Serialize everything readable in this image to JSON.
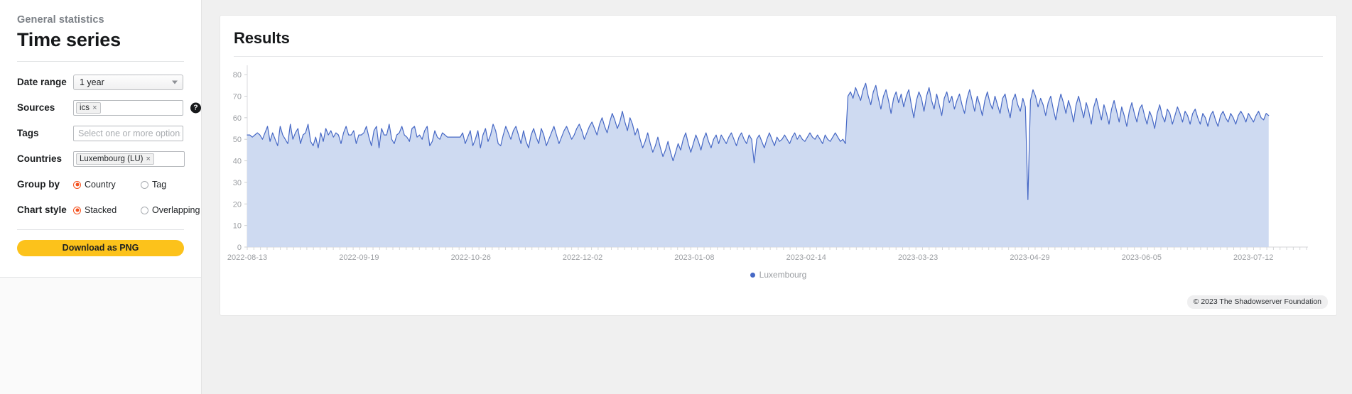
{
  "sidebar": {
    "eyebrow": "General statistics",
    "title": "Time series",
    "fields": {
      "date_range": {
        "label": "Date range",
        "value": "1 year"
      },
      "sources": {
        "label": "Sources",
        "chips": [
          "ics"
        ],
        "help_icon": "question-mark-icon"
      },
      "tags": {
        "label": "Tags",
        "placeholder": "Select one or more options...",
        "value": ""
      },
      "countries": {
        "label": "Countries",
        "chips": [
          "Luxembourg (LU)"
        ]
      },
      "group_by": {
        "label": "Group by",
        "selected": "Country",
        "options": [
          "Country",
          "Tag"
        ]
      },
      "chart_style": {
        "label": "Chart style",
        "selected": "Stacked",
        "options": [
          "Stacked",
          "Overlapping"
        ]
      }
    },
    "download_button": "Download as PNG",
    "chip_remove_icon": "×",
    "caret_icon": "chevron-down-icon"
  },
  "main": {
    "card_title": "Results",
    "copyright": "© 2023 The Shadowserver Foundation"
  },
  "colors": {
    "accent_radio": "#f4511e",
    "button": "#fcc21b",
    "series_line": "#4668c5",
    "series_fill": "#cbd8f0",
    "axis_text": "#9b9ea2",
    "page_bg": "#f0f0f0"
  },
  "chart_data": {
    "type": "area",
    "title": "Results",
    "xlabel": "",
    "ylabel": "",
    "ylim": [
      0,
      83
    ],
    "yticks": [
      0,
      10,
      20,
      30,
      40,
      50,
      60,
      70,
      80
    ],
    "grid": false,
    "legend": [
      "Luxembourg"
    ],
    "legend_position": "bottom",
    "stacked": true,
    "x_tick_labels": [
      "2022-08-13",
      "2022-09-19",
      "2022-10-26",
      "2022-12-02",
      "2023-01-08",
      "2023-02-14",
      "2023-03-23",
      "2023-04-29",
      "2023-06-05",
      "2023-07-12"
    ],
    "x_start": "2022-08-13",
    "x_end": "2023-08-12",
    "series": [
      {
        "name": "Luxembourg",
        "color": "#4668c5",
        "values": [
          52,
          52,
          51,
          52,
          53,
          52,
          50,
          53,
          56,
          49,
          53,
          50,
          47,
          56,
          52,
          50,
          48,
          57,
          50,
          53,
          55,
          48,
          52,
          53,
          57,
          49,
          47,
          51,
          46,
          53,
          49,
          55,
          52,
          54,
          51,
          53,
          52,
          48,
          53,
          56,
          52,
          52,
          54,
          48,
          52,
          52,
          53,
          56,
          51,
          47,
          54,
          56,
          46,
          55,
          52,
          52,
          57,
          50,
          48,
          52,
          53,
          56,
          52,
          51,
          49,
          55,
          56,
          51,
          52,
          50,
          54,
          56,
          47,
          49,
          54,
          51,
          50,
          53,
          52,
          51,
          51,
          51,
          51,
          51,
          51,
          53,
          48,
          51,
          54,
          47,
          50,
          54,
          46,
          52,
          55,
          49,
          52,
          57,
          54,
          48,
          47,
          52,
          56,
          53,
          50,
          54,
          56,
          52,
          48,
          54,
          49,
          46,
          52,
          55,
          51,
          48,
          55,
          52,
          47,
          50,
          53,
          56,
          52,
          48,
          51,
          54,
          56,
          53,
          50,
          52,
          55,
          57,
          54,
          50,
          53,
          56,
          58,
          55,
          52,
          57,
          60,
          56,
          53,
          58,
          62,
          59,
          55,
          58,
          63,
          58,
          54,
          60,
          57,
          52,
          55,
          50,
          46,
          49,
          53,
          48,
          44,
          47,
          51,
          46,
          42,
          45,
          49,
          44,
          40,
          44,
          48,
          45,
          50,
          53,
          48,
          44,
          48,
          52,
          49,
          45,
          50,
          53,
          49,
          46,
          50,
          52,
          48,
          52,
          50,
          48,
          51,
          53,
          50,
          47,
          51,
          53,
          50,
          48,
          52,
          50,
          39,
          50,
          52,
          49,
          46,
          50,
          53,
          50,
          47,
          51,
          49,
          50,
          52,
          50,
          48,
          51,
          53,
          50,
          52,
          50,
          49,
          51,
          53,
          51,
          50,
          52,
          50,
          48,
          52,
          50,
          49,
          51,
          53,
          51,
          49,
          50,
          48,
          70,
          72,
          69,
          74,
          71,
          68,
          73,
          76,
          70,
          66,
          72,
          75,
          69,
          64,
          70,
          73,
          68,
          62,
          69,
          72,
          67,
          71,
          65,
          70,
          73,
          66,
          60,
          68,
          72,
          69,
          63,
          70,
          74,
          68,
          64,
          71,
          66,
          61,
          69,
          72,
          67,
          70,
          64,
          68,
          71,
          66,
          62,
          69,
          73,
          68,
          63,
          70,
          66,
          61,
          68,
          72,
          67,
          64,
          70,
          66,
          62,
          69,
          71,
          65,
          60,
          68,
          71,
          66,
          63,
          69,
          65,
          22,
          68,
          73,
          70,
          65,
          69,
          66,
          61,
          67,
          70,
          64,
          59,
          66,
          71,
          67,
          62,
          68,
          64,
          58,
          66,
          70,
          65,
          60,
          67,
          63,
          57,
          65,
          69,
          64,
          59,
          66,
          62,
          57,
          64,
          68,
          63,
          58,
          65,
          61,
          56,
          63,
          67,
          62,
          58,
          64,
          66,
          61,
          57,
          63,
          60,
          55,
          62,
          66,
          61,
          58,
          64,
          62,
          57,
          61,
          65,
          62,
          58,
          63,
          61,
          57,
          62,
          64,
          60,
          57,
          62,
          60,
          56,
          61,
          63,
          59,
          56,
          61,
          63,
          60,
          58,
          62,
          60,
          57,
          61,
          63,
          61,
          58,
          62,
          60,
          58,
          61,
          63,
          60,
          59,
          62,
          61
        ]
      }
    ]
  }
}
